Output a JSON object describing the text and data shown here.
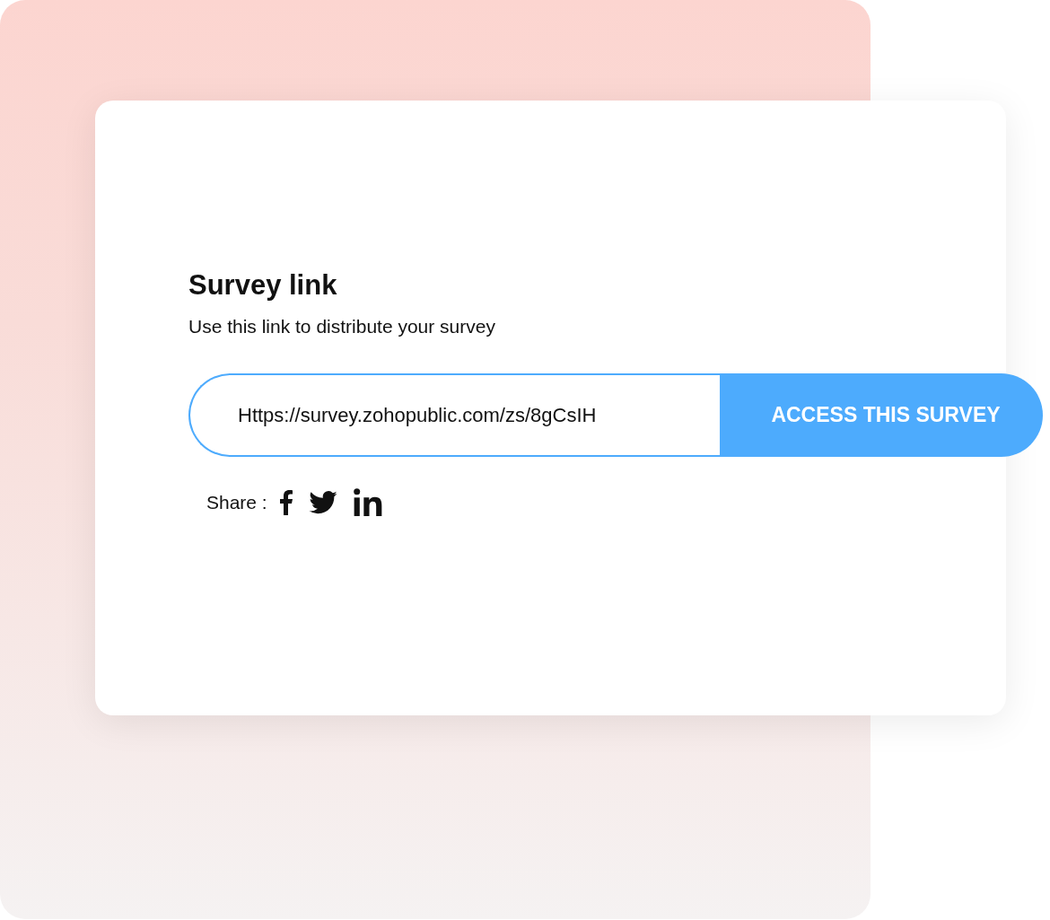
{
  "card": {
    "title": "Survey link",
    "subtitle": "Use this link to distribute your survey"
  },
  "link_field": {
    "value": "Https://survey.zohopublic.com/zs/8gCsIH"
  },
  "access_button": {
    "label": "ACCESS THIS SURVEY"
  },
  "share": {
    "label": "Share :"
  }
}
